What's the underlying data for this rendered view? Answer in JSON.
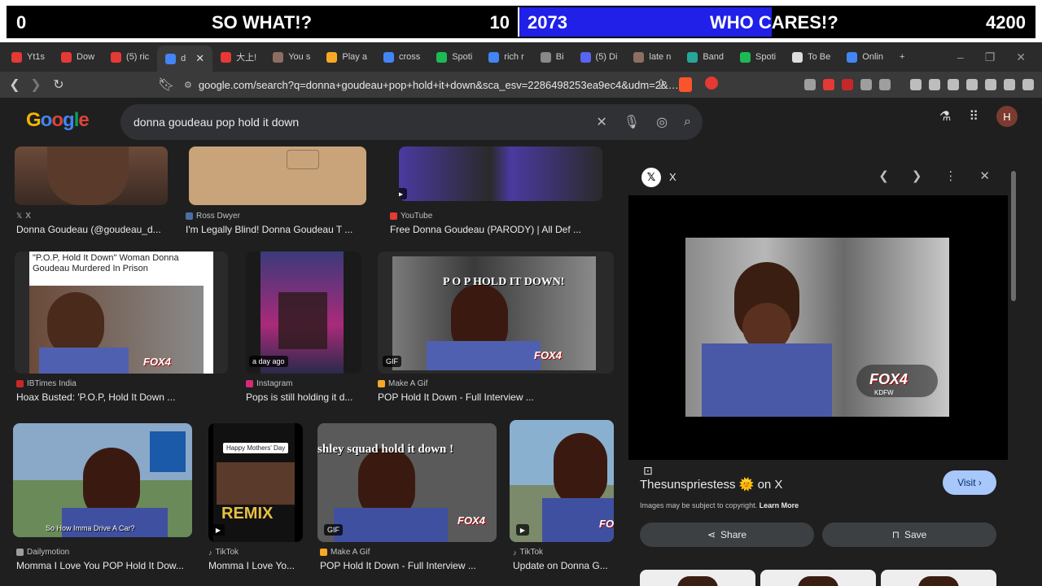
{
  "overlay": {
    "left_score": "0",
    "left_label": "SO WHAT!?",
    "left_number": "10",
    "right_score": "2073",
    "right_label": "WHO CARES!?",
    "right_number": "4200",
    "right_progress": 0.49,
    "fill_color": "#2020e8"
  },
  "tabs": [
    {
      "label": "Yt1s",
      "color": "#e53935"
    },
    {
      "label": "Dow",
      "color": "#e53935"
    },
    {
      "label": "(5) ric",
      "color": "#e53935"
    },
    {
      "label": "d",
      "color": "#4285f4",
      "active": true
    },
    {
      "label": "大上!",
      "color": "#e53935"
    },
    {
      "label": "You s",
      "color": "#8d6e63"
    },
    {
      "label": "Play a",
      "color": "#f9a825"
    },
    {
      "label": "cross",
      "color": "#4285f4"
    },
    {
      "label": "Spoti",
      "color": "#1db954"
    },
    {
      "label": "rich r",
      "color": "#4285f4"
    },
    {
      "label": "Bi",
      "color": "#888"
    },
    {
      "label": "(5) Di",
      "color": "#5865f2"
    },
    {
      "label": "late n",
      "color": "#8d6e63"
    },
    {
      "label": "Band",
      "color": "#26a69a"
    },
    {
      "label": "Spoti",
      "color": "#1db954"
    },
    {
      "label": "To Be",
      "color": "#ddd"
    },
    {
      "label": "Onlin",
      "color": "#4285f4"
    }
  ],
  "tab_add": "+",
  "window_controls": {
    "min": "–",
    "max": "❐",
    "close": "✕"
  },
  "address": {
    "url": "google.com/search?q=donna+goudeau+pop+hold+it+down&sca_esv=2286498253ea9ec4&udm=2&…"
  },
  "google": {
    "logo": "Google",
    "query": "donna goudeau pop hold it down",
    "avatar_initial": "H"
  },
  "results": [
    {
      "source": "X",
      "title": "Donna Goudeau (@goudeau_d..."
    },
    {
      "source": "Ross Dwyer",
      "title": "I'm Legally Blind! Donna Goudeau T ..."
    },
    {
      "source": "YouTube",
      "title": "Free Donna Goudeau (PARODY) | All Def ..."
    },
    {
      "source": "IBTimes India",
      "title": "Hoax Busted: 'P.O.P, Hold It Down ...",
      "overlay_text": "\"P.O.P, Hold It Down\" Woman Donna Goudeau Murdered In Prison"
    },
    {
      "source": "Instagram",
      "title": "Pops is still holding it d...",
      "badge": "a day ago"
    },
    {
      "source": "Make A Gif",
      "title": "POP Hold It Down - Full Interview ...",
      "overlay_text": "P O P HOLD IT DOWN!",
      "badge": "GIF"
    },
    {
      "source": "Dailymotion",
      "title": "Momma I Love You POP Hold It Dow...",
      "overlay_text": "So How Imma Drive A Car?"
    },
    {
      "source": "TikTok",
      "title": "Momma I Love Yo...",
      "overlay_text": "Happy Mothers' Day",
      "overlay_text2": "REMIX"
    },
    {
      "source": "Make A Gif",
      "title": "POP Hold It Down - Full Interview ...",
      "overlay_text": "shley squad hold it down !",
      "badge": "GIF"
    },
    {
      "source": "TikTok",
      "title": "Update on Donna G..."
    }
  ],
  "panel": {
    "source": "X",
    "title": "Thesunspriestess 🌞 on X",
    "visit": "Visit",
    "copyright": "Images may be subject to copyright.",
    "learn_more": "Learn More",
    "share": "Share",
    "save": "Save",
    "station": "FOX4",
    "station_sub": "KDFW"
  }
}
